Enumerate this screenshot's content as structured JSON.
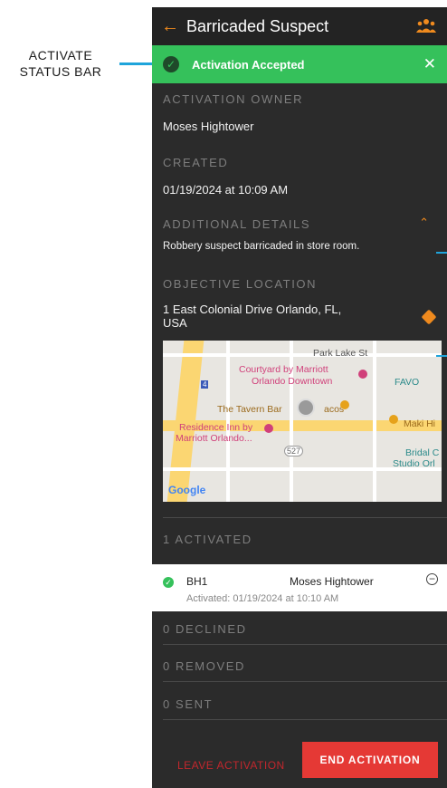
{
  "callout": {
    "line1": "ACTIVATE",
    "line2": "STATUS BAR",
    "color": "#1fa4db"
  },
  "appbar": {
    "title": "Barricaded Suspect",
    "back_icon": "arrow-left-icon",
    "right_icon": "people-group-icon"
  },
  "status_bar": {
    "text": "Activation Accepted",
    "icon": "check-circle-icon",
    "close_icon": "close-icon",
    "color": "#35c15b"
  },
  "sections": {
    "owner_label": "ACTIVATION OWNER",
    "owner_value": "Moses Hightower",
    "created_label": "CREATED",
    "created_value": "01/19/2024 at 10:09 AM",
    "details_label": "ADDITIONAL DETAILS",
    "details_value": "Robbery suspect barricaded in store room.",
    "location_label": "OBJECTIVE LOCATION",
    "location_line1": "1 East Colonial Drive Orlando, FL,",
    "location_line2": "USA"
  },
  "map": {
    "labels": {
      "park_lake": "Park Lake St",
      "courtyard1": "Courtyard by Marriott",
      "courtyard2": "Orlando Downtown",
      "tavern": "The Tavern Bar",
      "tacos": "acos",
      "residence1": "Residence Inn by",
      "residence2": "Marriott Orlando...",
      "favo": "FAVO",
      "maki": "Maki Hi",
      "bridal1": "Bridal C",
      "bridal2": "Studio Orl",
      "route_527": "527",
      "route_4": "4",
      "google": "Google"
    }
  },
  "activated": {
    "header": "1 ACTIVATED",
    "unit": "BH1",
    "person": "Moses Hightower",
    "meta_label": "Activated:",
    "meta_value": "01/19/2024 at 10:10 AM"
  },
  "lists": {
    "declined": "0 DECLINED",
    "removed": "0 REMOVED",
    "sent": "0 SENT"
  },
  "actions": {
    "leave": "LEAVE ACTIVATION",
    "end": "END ACTIVATION"
  },
  "colors": {
    "accent": "#ef8a1e",
    "danger": "#e53935"
  }
}
